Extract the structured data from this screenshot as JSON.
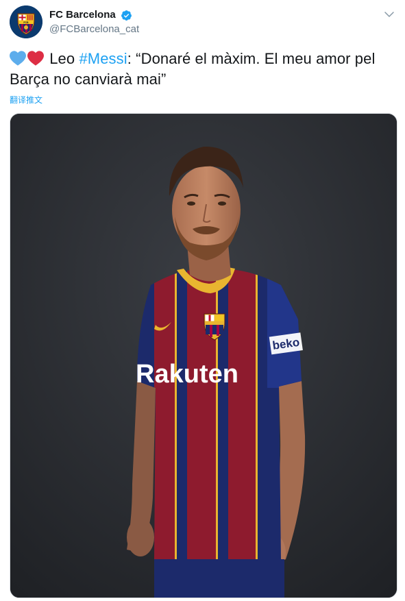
{
  "account": {
    "display_name": "FC Barcelona",
    "handle": "@FCBarcelona_cat",
    "avatar_icon": "fc-barcelona-crest-icon",
    "verified_icon": "verified-badge-icon",
    "verified_color": "#1da1f2"
  },
  "tweet": {
    "emojis": [
      "blue-heart-icon",
      "red-heart-icon"
    ],
    "text_part1": "Leo ",
    "hashtag": "#Messi",
    "text_part2": ":   “Donaré el màxim. El meu amor pel Barça no canviarà mai”",
    "translate_label": "翻译推文"
  },
  "colors": {
    "link": "#1da1f2",
    "text": "#14171a",
    "muted": "#657786",
    "jersey_red": "#8e1b2e",
    "jersey_blue": "#1c2a6b",
    "jersey_gold": "#e9b530"
  },
  "media": {
    "kind": "photo",
    "subject": "player-portrait",
    "jersey_sponsor": "Rakuten",
    "sleeve_sponsor": "beko"
  }
}
